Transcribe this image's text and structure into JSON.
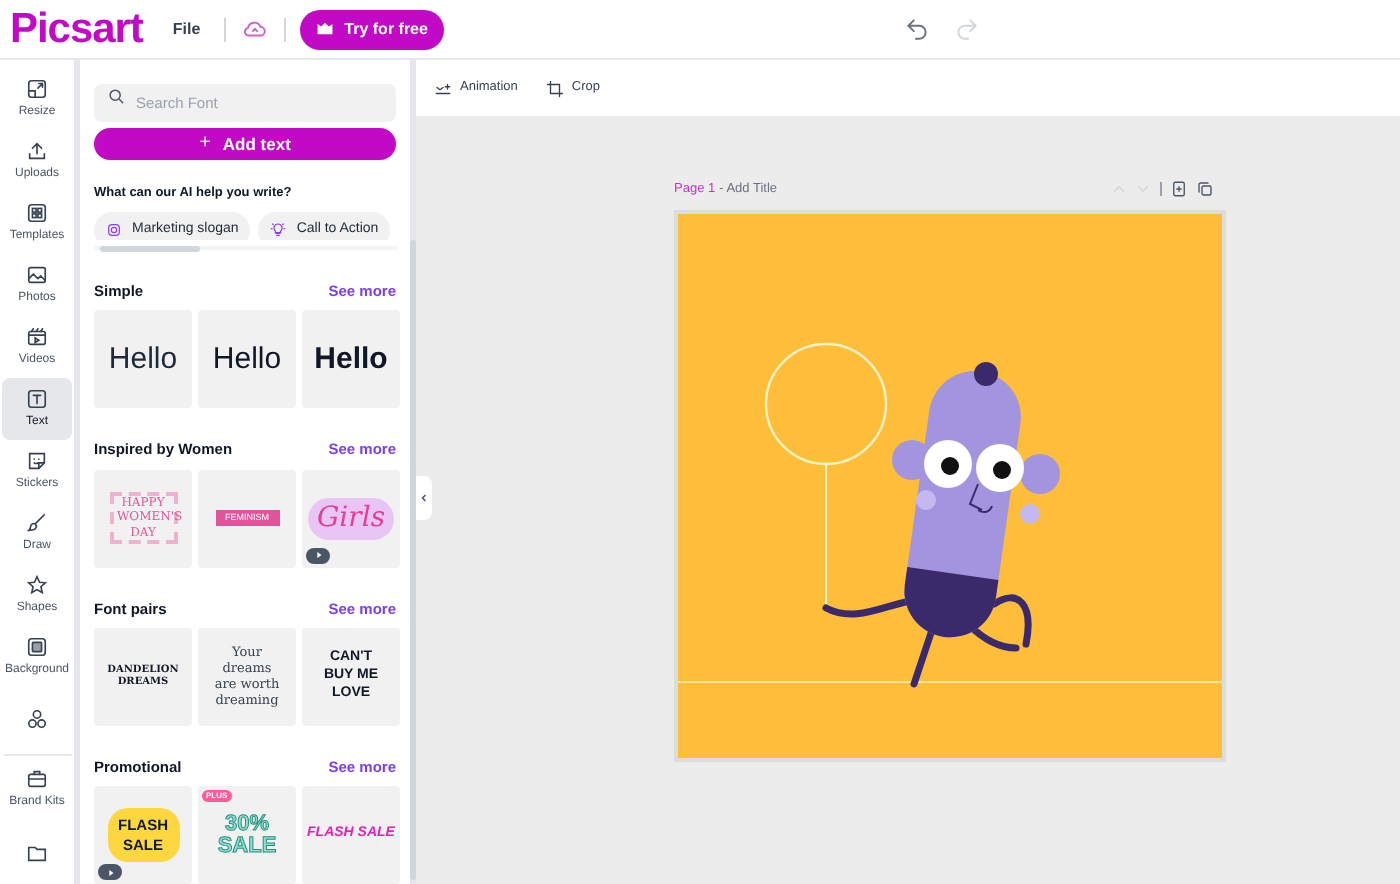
{
  "app": {
    "logo": "Picsart",
    "file_menu": "File",
    "try_button": "Try for free"
  },
  "rail": [
    {
      "label": "Resize",
      "selected": false
    },
    {
      "label": "Uploads",
      "selected": false
    },
    {
      "label": "Templates",
      "selected": false
    },
    {
      "label": "Photos",
      "selected": false
    },
    {
      "label": "Videos",
      "selected": false
    },
    {
      "label": "Text",
      "selected": true
    },
    {
      "label": "Stickers",
      "selected": false
    },
    {
      "label": "Draw",
      "selected": false
    },
    {
      "label": "Shapes",
      "selected": false
    },
    {
      "label": "Background",
      "selected": false
    },
    {
      "selected": false
    },
    {
      "label": "Brand Kits",
      "selected": false
    },
    {
      "selected": false
    }
  ],
  "panel": {
    "search": {
      "placeholder": "Search Font"
    },
    "add_button": {
      "icon_text": "+",
      "label": "Add text"
    },
    "ai_prompt": "What can our AI help you write?",
    "chips": [
      {
        "label": "Marketing slogan"
      },
      {
        "label": "Call to Action"
      }
    ],
    "sections": [
      {
        "title": "Simple",
        "see_more": "See more",
        "tiles": [
          {
            "kind": "light",
            "text": "Hello"
          },
          {
            "kind": "regular",
            "text": "Hello"
          },
          {
            "kind": "bold",
            "text": "Hello"
          }
        ]
      },
      {
        "title": "Inspired by Women",
        "see_more": "See more",
        "tiles": [
          {
            "kind": "womens",
            "text": "HAPPY WOMEN'S DAY"
          },
          {
            "kind": "ribbon",
            "text": "FEMINISM"
          },
          {
            "kind": "girls",
            "text": "Girls",
            "video": true
          }
        ]
      },
      {
        "title": "Font pairs",
        "see_more": "See more",
        "tiles": [
          {
            "kind": "dandelion",
            "text": "DANDELION DREAMS"
          },
          {
            "kind": "serif",
            "text": "Your dreams are worth dreaming"
          },
          {
            "kind": "cantbuy",
            "text": "CAN'T BUY ME LOVE"
          }
        ]
      },
      {
        "title": "Promotional",
        "see_more": "See more",
        "tiles": [
          {
            "kind": "flash",
            "text": "FLASH SALE",
            "video": true
          },
          {
            "kind": "percent",
            "text": "30% SALE",
            "badge": "PLUS"
          },
          {
            "kind": "flashpink",
            "text": "FLASH SALE"
          }
        ]
      }
    ]
  },
  "toolbar": [
    {
      "label": "Animation"
    },
    {
      "label": "Crop"
    }
  ],
  "page": {
    "number": "Page 1",
    "title_placeholder": "- Add Title"
  }
}
